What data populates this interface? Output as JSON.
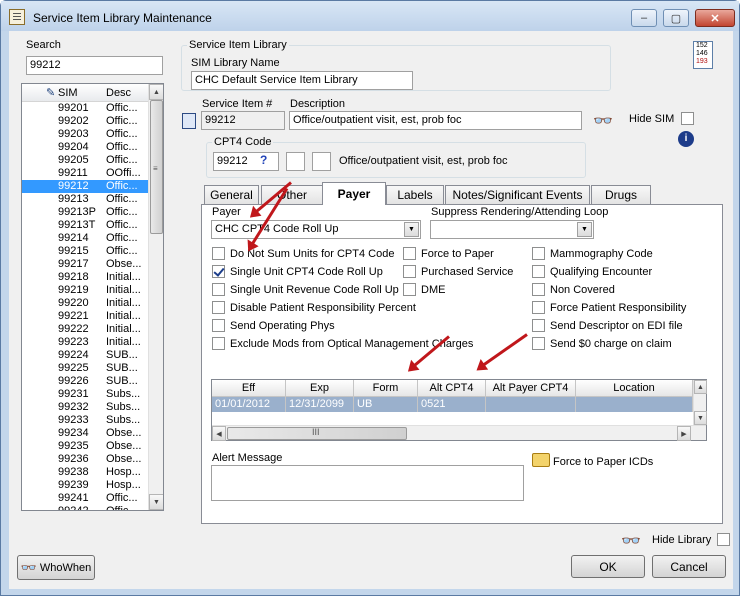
{
  "window": {
    "title": "Service Item Library Maintenance"
  },
  "search": {
    "label": "Search",
    "value": "99212"
  },
  "list": {
    "headers": [
      "SIM",
      "Desc"
    ],
    "rows": [
      {
        "sim": "99201",
        "desc": "Offic..."
      },
      {
        "sim": "99202",
        "desc": "Offic..."
      },
      {
        "sim": "99203",
        "desc": "Offic..."
      },
      {
        "sim": "99204",
        "desc": "Offic..."
      },
      {
        "sim": "99205",
        "desc": "Offic..."
      },
      {
        "sim": "99211",
        "desc": "OOffi..."
      },
      {
        "sim": "99212",
        "desc": "Offic...",
        "selected": true
      },
      {
        "sim": "99213",
        "desc": "Offic..."
      },
      {
        "sim": "99213P",
        "desc": "Offic..."
      },
      {
        "sim": "99213T",
        "desc": "Offic..."
      },
      {
        "sim": "99214",
        "desc": "Offic..."
      },
      {
        "sim": "99215",
        "desc": "Offic..."
      },
      {
        "sim": "99217",
        "desc": "Obse..."
      },
      {
        "sim": "99218",
        "desc": "Initial..."
      },
      {
        "sim": "99219",
        "desc": "Initial..."
      },
      {
        "sim": "99220",
        "desc": "Initial..."
      },
      {
        "sim": "99221",
        "desc": "Initial..."
      },
      {
        "sim": "99222",
        "desc": "Initial..."
      },
      {
        "sim": "99223",
        "desc": "Initial..."
      },
      {
        "sim": "99224",
        "desc": "SUB..."
      },
      {
        "sim": "99225",
        "desc": "SUB..."
      },
      {
        "sim": "99226",
        "desc": "SUB..."
      },
      {
        "sim": "99231",
        "desc": "Subs..."
      },
      {
        "sim": "99232",
        "desc": "Subs..."
      },
      {
        "sim": "99233",
        "desc": "Subs..."
      },
      {
        "sim": "99234",
        "desc": "Obse..."
      },
      {
        "sim": "99235",
        "desc": "Obse..."
      },
      {
        "sim": "99236",
        "desc": "Obse..."
      },
      {
        "sim": "99238",
        "desc": "Hosp..."
      },
      {
        "sim": "99239",
        "desc": "Hosp..."
      },
      {
        "sim": "99241",
        "desc": "Offic..."
      },
      {
        "sim": "99242",
        "desc": "Offic..."
      }
    ]
  },
  "library": {
    "group_label": "Service Item Library",
    "name_label": "SIM Library Name",
    "name_value": "CHC Default Service Item Library"
  },
  "item": {
    "number_label": "Service Item #",
    "number_value": "99212",
    "description_label": "Description",
    "description_value": "Office/outpatient visit, est, prob foc",
    "hide_sim_label": "Hide SIM"
  },
  "cpt4": {
    "label": "CPT4 Code",
    "value": "99212",
    "help": "?",
    "description": "Office/outpatient visit, est, prob foc"
  },
  "tabs": [
    {
      "label": "General",
      "underline": "G"
    },
    {
      "label": "Other",
      "underline": "O"
    },
    {
      "label": "Payer",
      "underline": "P",
      "active": true
    },
    {
      "label": "Labels",
      "underline": "L"
    },
    {
      "label": "Notes/Significant Events",
      "underline": "N"
    },
    {
      "label": "Drugs",
      "underline": "D"
    }
  ],
  "payer_tab": {
    "payer_label": "Payer",
    "payer_value": "CHC CPT4 Code Roll Up",
    "suppress_label": "Suppress Rendering/Attending Loop",
    "suppress_value": "",
    "checkboxes_col1": [
      {
        "label": "Do Not Sum Units for CPT4 Code",
        "checked": false
      },
      {
        "label": "Single Unit CPT4 Code Roll Up",
        "checked": true
      },
      {
        "label": "Single Unit Revenue Code Roll Up",
        "checked": false
      },
      {
        "label": "Disable Patient Responsibility Percent",
        "checked": false
      },
      {
        "label": "Send Operating Phys",
        "checked": false
      },
      {
        "label": "Exclude Mods from Optical Management Charges",
        "checked": false
      }
    ],
    "checkboxes_col2": [
      {
        "label": "Force to Paper",
        "checked": false
      },
      {
        "label": "Purchased Service",
        "checked": false
      },
      {
        "label": "DME",
        "checked": false
      }
    ],
    "checkboxes_col3": [
      {
        "label": "Mammography Code",
        "checked": false
      },
      {
        "label": "Qualifying Encounter",
        "checked": false
      },
      {
        "label": "Non Covered",
        "checked": false
      },
      {
        "label": "Force Patient Responsibility",
        "checked": false
      },
      {
        "label": "Send Descriptor on EDI file",
        "checked": false
      },
      {
        "label": "Send $0 charge on claim",
        "checked": false
      }
    ],
    "grid": {
      "headers": [
        "Eff",
        "Exp",
        "Form",
        "Alt CPT4",
        "Alt Payer CPT4",
        "Location"
      ],
      "rows": [
        [
          "01/01/2012",
          "12/31/2099",
          "UB",
          "0521",
          "",
          ""
        ]
      ],
      "hscroll_grip": "III"
    },
    "alert_label": "Alert Message",
    "alert_value": "",
    "force_paper_icds_label": "Force to Paper ICDs"
  },
  "footer": {
    "hide_library_label": "Hide Library",
    "whowhen_label": "WhoWhen",
    "ok_label": "OK",
    "cancel_label": "Cancel"
  },
  "calendar_icon": {
    "lines": [
      "152",
      "146",
      "193"
    ]
  },
  "colors": {
    "selection": "#3399ff",
    "grid_selection": "#9ab0cc",
    "annotation_arrow": "#c0171b"
  }
}
